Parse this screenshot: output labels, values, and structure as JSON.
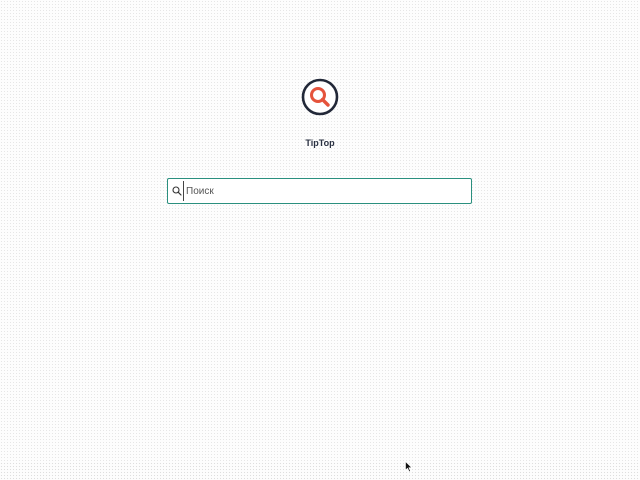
{
  "app": {
    "name": "TipTop"
  },
  "search": {
    "placeholder": "Поиск",
    "value": ""
  },
  "colors": {
    "logo_accent": "#e5533c",
    "logo_ring": "#222838",
    "search_border": "#2a8f7e"
  },
  "icons": {
    "logo": "magnifier-logo-icon",
    "search": "search-icon",
    "cursor": "mouse-pointer-icon"
  }
}
